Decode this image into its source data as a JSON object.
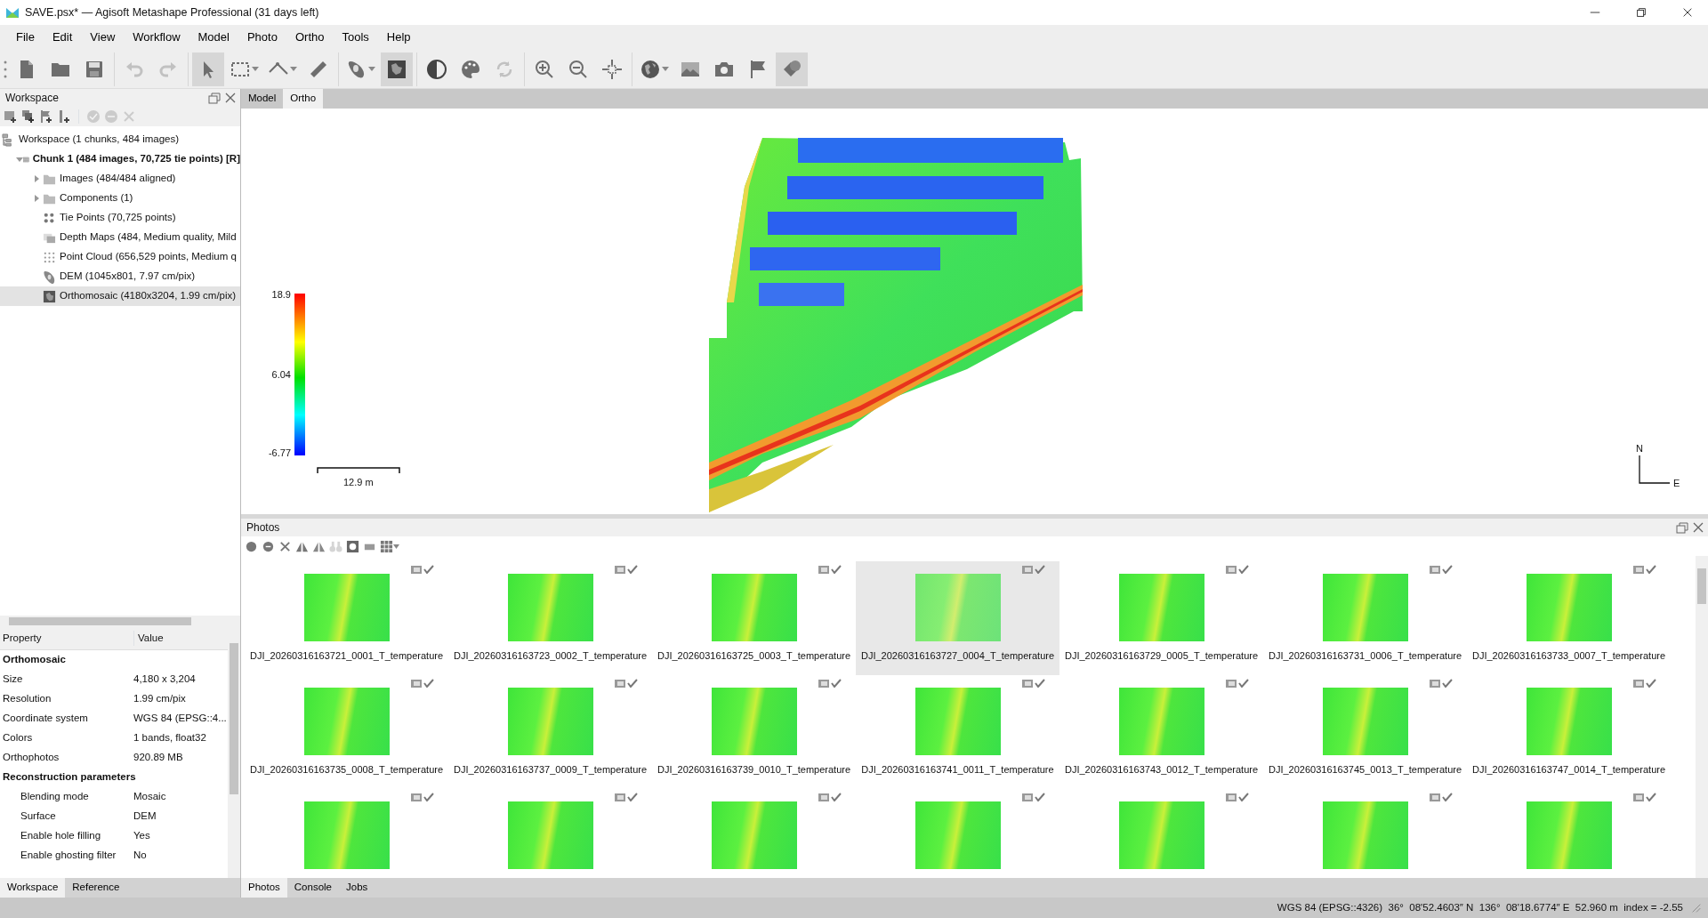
{
  "window": {
    "title": "SAVE.psx* — Agisoft Metashape Professional (31 days left)"
  },
  "menu": [
    "File",
    "Edit",
    "View",
    "Workflow",
    "Model",
    "Photo",
    "Ortho",
    "Tools",
    "Help"
  ],
  "toolbar_groups": [
    [
      {
        "disabled": false,
        "pressed": false,
        "dropdown": false
      },
      {
        "disabled": false,
        "pressed": false,
        "dropdown": false
      },
      {
        "disabled": false,
        "pressed": false,
        "dropdown": false
      }
    ],
    [
      {
        "disabled": true,
        "pressed": false,
        "dropdown": false
      },
      {
        "disabled": true,
        "pressed": false,
        "dropdown": false
      }
    ],
    [
      {
        "disabled": false,
        "pressed": true,
        "dropdown": false
      },
      {
        "disabled": false,
        "pressed": false,
        "dropdown": true
      },
      {
        "disabled": false,
        "pressed": false,
        "dropdown": true
      },
      {
        "disabled": false,
        "pressed": false,
        "dropdown": false
      }
    ],
    [
      {
        "disabled": false,
        "pressed": false,
        "dropdown": true
      },
      {
        "disabled": false,
        "pressed": true,
        "dropdown": false
      }
    ],
    [
      {
        "disabled": false,
        "pressed": false,
        "dropdown": false
      },
      {
        "disabled": false,
        "pressed": false,
        "dropdown": false
      },
      {
        "disabled": true,
        "pressed": false,
        "dropdown": false
      }
    ],
    [
      {
        "disabled": false,
        "pressed": false,
        "dropdown": false
      },
      {
        "disabled": false,
        "pressed": false,
        "dropdown": false
      },
      {
        "disabled": false,
        "pressed": false,
        "dropdown": false
      }
    ],
    [
      {
        "disabled": false,
        "pressed": false,
        "dropdown": true
      },
      {
        "disabled": false,
        "pressed": false,
        "dropdown": false
      },
      {
        "disabled": false,
        "pressed": false,
        "dropdown": false
      },
      {
        "disabled": false,
        "pressed": false,
        "dropdown": false
      },
      {
        "disabled": false,
        "pressed": true,
        "dropdown": false
      }
    ]
  ],
  "workspace_panel": {
    "title": "Workspace",
    "toolbar": [
      {
        "disabled": false
      },
      {
        "disabled": false
      },
      {
        "disabled": false
      },
      {
        "disabled": false
      },
      {
        "disabled": true
      },
      {
        "disabled": true
      },
      {
        "disabled": true
      }
    ],
    "tree": [
      {
        "kind": "workspace",
        "label": "Workspace (1 chunks, 484 images)",
        "selected": false,
        "children": [
          {
            "kind": "chunk",
            "label": "Chunk 1 (484 images, 70,725 tie points) [R]",
            "selected": false,
            "expanded": true,
            "children": [
              {
                "kind": "folder",
                "label": "Images (484/484 aligned)",
                "selected": false,
                "expanded": false
              },
              {
                "kind": "folder",
                "label": "Components (1)",
                "selected": false,
                "expanded": false
              },
              {
                "kind": "tie_points",
                "label": "Tie Points (70,725 points)",
                "selected": false
              },
              {
                "kind": "depth_maps",
                "label": "Depth Maps (484, Medium quality, Mild",
                "selected": false
              },
              {
                "kind": "point_cloud",
                "label": "Point Cloud (656,529 points, Medium q",
                "selected": false
              },
              {
                "kind": "dem",
                "label": "DEM (1045x801, 7.97 cm/pix)",
                "selected": false
              },
              {
                "kind": "orthomosaic",
                "label": "Orthomosaic (4180x3204, 1.99 cm/pix)",
                "selected": true
              }
            ]
          }
        ]
      }
    ]
  },
  "properties": {
    "columns": [
      "Property",
      "Value"
    ],
    "rows": [
      {
        "kind": "header",
        "property": "Orthomosaic"
      },
      {
        "kind": "row",
        "property": "Size",
        "value": "4,180 x 3,204"
      },
      {
        "kind": "row",
        "property": "Resolution",
        "value": "1.99 cm/pix"
      },
      {
        "kind": "row",
        "property": "Coordinate system",
        "value": "WGS 84 (EPSG::4..."
      },
      {
        "kind": "row",
        "property": "Colors",
        "value": "1 bands, float32"
      },
      {
        "kind": "row",
        "property": "Orthophotos",
        "value": "920.89 MB"
      },
      {
        "kind": "header",
        "property": "Reconstruction parameters",
        "children": [
          {
            "kind": "row",
            "property": "Blending mode",
            "value": "Mosaic"
          },
          {
            "kind": "row",
            "property": "Surface",
            "value": "DEM"
          },
          {
            "kind": "row",
            "property": "Enable hole filling",
            "value": "Yes"
          },
          {
            "kind": "row",
            "property": "Enable ghosting filter",
            "value": "No"
          }
        ]
      }
    ]
  },
  "left_tabs": [
    {
      "label": "Workspace",
      "selected": true
    },
    {
      "label": "Reference",
      "selected": false
    }
  ],
  "view_tabs": [
    {
      "label": "Model",
      "selected": false
    },
    {
      "label": "Ortho",
      "selected": true
    }
  ],
  "viewport": {
    "colorbar_labels": [
      "18.9",
      "6.04",
      "-6.77"
    ],
    "scale_bar": "12.9 m",
    "compass": [
      "N",
      "E"
    ]
  },
  "photos_panel": {
    "title": "Photos",
    "toolbar": [
      {
        "disabled": false
      },
      {
        "disabled": false
      },
      {
        "disabled": false
      },
      {
        "disabled": false
      },
      {
        "disabled": false
      },
      {
        "disabled": true
      },
      {
        "disabled": false
      },
      {
        "disabled": false
      },
      {
        "disabled": false
      }
    ],
    "photos": [
      {
        "label": "DJI_20260316163721_0001_T_temperature",
        "selected": false,
        "checked": true
      },
      {
        "label": "DJI_20260316163723_0002_T_temperature",
        "selected": false,
        "checked": true
      },
      {
        "label": "DJI_20260316163725_0003_T_temperature",
        "selected": false,
        "checked": true
      },
      {
        "label": "DJI_20260316163727_0004_T_temperature",
        "selected": true,
        "checked": true
      },
      {
        "label": "DJI_20260316163729_0005_T_temperature",
        "selected": false,
        "checked": true
      },
      {
        "label": "DJI_20260316163731_0006_T_temperature",
        "selected": false,
        "checked": true
      },
      {
        "label": "DJI_20260316163733_0007_T_temperature",
        "selected": false,
        "checked": true
      },
      {
        "label": "DJI_20260316163735_0008_T_temperature",
        "selected": false,
        "checked": true
      },
      {
        "label": "DJI_20260316163737_0009_T_temperature",
        "selected": false,
        "checked": true
      },
      {
        "label": "DJI_20260316163739_0010_T_temperature",
        "selected": false,
        "checked": true
      },
      {
        "label": "DJI_20260316163741_0011_T_temperature",
        "selected": false,
        "checked": true
      },
      {
        "label": "DJI_20260316163743_0012_T_temperature",
        "selected": false,
        "checked": true
      },
      {
        "label": "DJI_20260316163745_0013_T_temperature",
        "selected": false,
        "checked": true
      },
      {
        "label": "DJI_20260316163747_0014_T_temperature",
        "selected": false,
        "checked": true
      },
      {
        "selected": false,
        "checked": true
      },
      {
        "selected": false,
        "checked": true
      },
      {
        "selected": false,
        "checked": true
      },
      {
        "selected": false,
        "checked": true
      },
      {
        "selected": false,
        "checked": true
      },
      {
        "selected": false,
        "checked": true
      },
      {
        "selected": false,
        "checked": true
      }
    ]
  },
  "bottom_tabs": [
    {
      "label": "Photos",
      "selected": true
    },
    {
      "label": "Console",
      "selected": false
    },
    {
      "label": "Jobs",
      "selected": false
    }
  ],
  "status_bar": "WGS 84 (EPSG::4326)  36°  08'52.4603″ N  136°  08'18.6774″ E  52.960 m  index = -2.55"
}
